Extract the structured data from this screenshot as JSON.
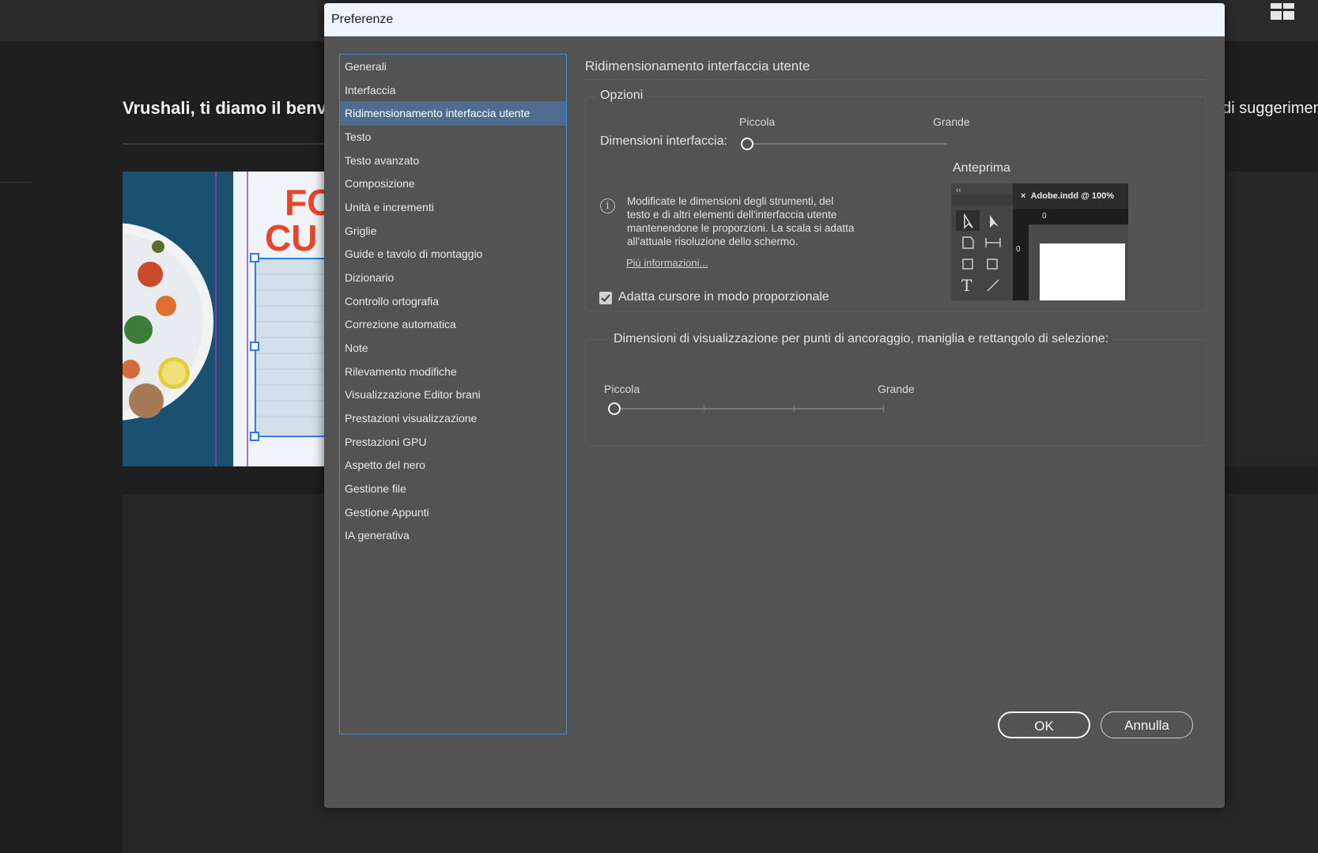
{
  "background": {
    "welcome_text": "Vrushali, ti diamo il benve",
    "right_text": "ndi suggeriment",
    "thumb_text_1": "FO",
    "thumb_text_2": "CU"
  },
  "dialog": {
    "title": "Preferenze",
    "categories": [
      "Generali",
      "Interfaccia",
      "Ridimensionamento interfaccia utente",
      "Testo",
      "Testo avanzato",
      "Composizione",
      "Unità e incrementi",
      "Griglie",
      "Guide e tavolo di montaggio",
      "Dizionario",
      "Controllo ortografia",
      "Correzione automatica",
      "Note",
      "Rilevamento modifiche",
      "Visualizzazione Editor brani",
      "Prestazioni visualizzazione",
      "Prestazioni GPU",
      "Aspetto del nero",
      "Gestione file",
      "Gestione Appunti",
      "IA generativa"
    ],
    "selected_category": "Ridimensionamento interfaccia utente",
    "section_title": "Ridimensionamento interfaccia utente",
    "options": {
      "group_label": "Opzioni",
      "size_label": "Dimensioni interfaccia:",
      "min_label": "Piccola",
      "max_label": "Grande",
      "slider_value": 0,
      "info_text": "Modificate le dimensioni degli strumenti, del testo e di altri elementi dell'interfaccia utente mantenendone le proporzioni. La scala si adatta all'attuale risoluzione dello schermo.",
      "info_link": "Più informazioni...",
      "checkbox_label": "Adatta cursore in modo proporzionale",
      "checkbox_checked": true,
      "preview_label": "Anteprima",
      "preview_tab": "Adobe.indd @ 100%",
      "preview_ruler_h": "0",
      "preview_ruler_v": "0",
      "preview_collapse": "‹‹"
    },
    "anchor": {
      "label": "Dimensioni di visualizzazione per punti di ancoraggio, maniglia e rettangolo di selezione:",
      "min_label": "Piccola",
      "max_label": "Grande",
      "slider_value": 0
    },
    "buttons": {
      "ok": "OK",
      "cancel": "Annulla"
    }
  },
  "colors": {
    "dialog_bg": "#535353",
    "selection": "#4f6c8e",
    "list_border": "#4a8ad0"
  }
}
